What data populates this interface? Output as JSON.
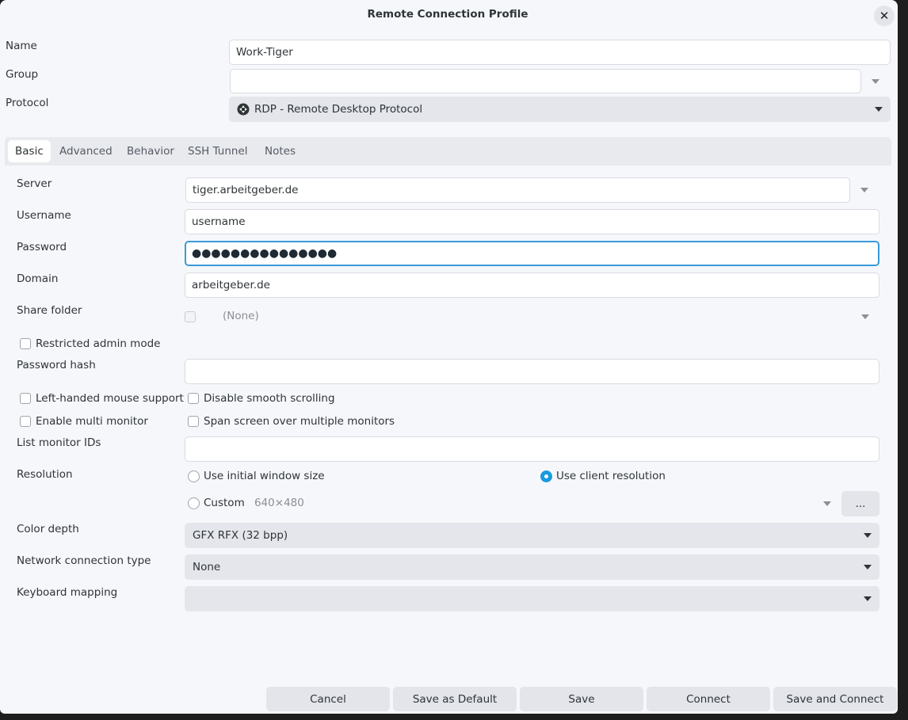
{
  "window": {
    "title": "Remote Connection Profile"
  },
  "profile": {
    "name_label": "Name",
    "name_value": "Work-Tiger",
    "group_label": "Group",
    "group_value": "",
    "protocol_label": "Protocol",
    "protocol_value": "RDP - Remote Desktop Protocol"
  },
  "tabs": [
    "Basic",
    "Advanced",
    "Behavior",
    "SSH Tunnel",
    "Notes"
  ],
  "basic": {
    "server_label": "Server",
    "server_value": "tiger.arbeitgeber.de",
    "username_label": "Username",
    "username_value": "username",
    "password_label": "Password",
    "password_value": "●●●●●●●●●●●●●●●",
    "domain_label": "Domain",
    "domain_value": "arbeitgeber.de",
    "share_folder_label": "Share folder",
    "share_folder_value": "(None)",
    "restricted_admin_label": "Restricted admin mode",
    "password_hash_label": "Password hash",
    "password_hash_value": "",
    "left_handed_label": "Left-handed mouse support",
    "disable_smooth_label": "Disable smooth scrolling",
    "multi_monitor_label": "Enable multi monitor",
    "span_screen_label": "Span screen over multiple monitors",
    "monitor_ids_label": "List monitor IDs",
    "monitor_ids_value": "",
    "resolution_label": "Resolution",
    "res_initial_label": "Use initial window size",
    "res_client_label": "Use client resolution",
    "res_custom_label": "Custom",
    "res_custom_value": "640×480",
    "res_more_label": "...",
    "color_depth_label": "Color depth",
    "color_depth_value": "GFX RFX (32 bpp)",
    "network_label": "Network connection type",
    "network_value": "None",
    "keyboard_label": "Keyboard mapping",
    "keyboard_value": ""
  },
  "buttons": {
    "cancel": "Cancel",
    "save_default": "Save as Default",
    "save": "Save",
    "connect": "Connect",
    "save_connect": "Save and Connect"
  },
  "colors": {
    "accent": "#1a9be0",
    "focus_border": "#3a9ad9"
  }
}
